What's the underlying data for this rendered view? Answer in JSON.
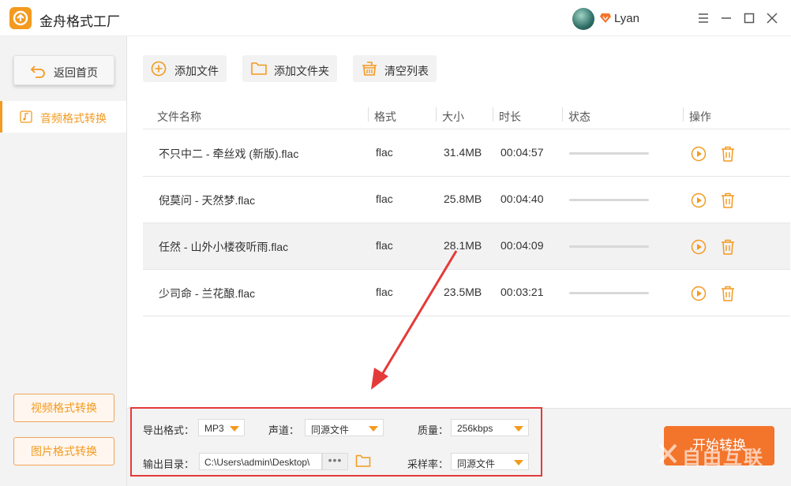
{
  "app": {
    "title": "金舟格式工厂"
  },
  "user": {
    "name": "Lyan"
  },
  "window_controls": {
    "menu": "menu-icon",
    "minimize": "minimize-icon",
    "maximize": "maximize-icon",
    "close": "close-icon"
  },
  "sidebar": {
    "home_label": "返回首页",
    "active_item": "音频格式转换",
    "video_label": "视频格式转换",
    "image_label": "图片格式转换"
  },
  "toolbar": {
    "add_file": "添加文件",
    "add_folder": "添加文件夹",
    "clear_list": "清空列表"
  },
  "table": {
    "columns": [
      "文件名称",
      "格式",
      "大小",
      "时长",
      "状态",
      "操作"
    ],
    "rows": [
      {
        "name": "不只中二 - 牵丝戏 (新版).flac",
        "format": "flac",
        "size": "31.4MB",
        "duration": "00:04:57",
        "progress": 0
      },
      {
        "name": "倪莫问 - 天然梦.flac",
        "format": "flac",
        "size": "25.8MB",
        "duration": "00:04:40",
        "progress": 0
      },
      {
        "name": "任然 - 山外小楼夜听雨.flac",
        "format": "flac",
        "size": "28.1MB",
        "duration": "00:04:09",
        "progress": 0
      },
      {
        "name": "少司命 - 兰花酿.flac",
        "format": "flac",
        "size": "23.5MB",
        "duration": "00:03:21",
        "progress": 0
      }
    ]
  },
  "settings": {
    "export_format_label": "导出格式：",
    "export_format_value": "MP3",
    "channel_label": "声道：",
    "channel_value": "同源文件",
    "quality_label": "质量：",
    "quality_value": "256kbps",
    "output_dir_label": "输出目录：",
    "output_dir_value": "C:\\Users\\admin\\Desktop\\",
    "browse_label": "•••",
    "sample_rate_label": "采样率：",
    "sample_rate_value": "同源文件"
  },
  "start_button": "开始转换",
  "watermark": "自由互联",
  "colors": {
    "accent": "#f39a1f",
    "start": "#f3742b",
    "highlight_box": "#e53a3a"
  }
}
